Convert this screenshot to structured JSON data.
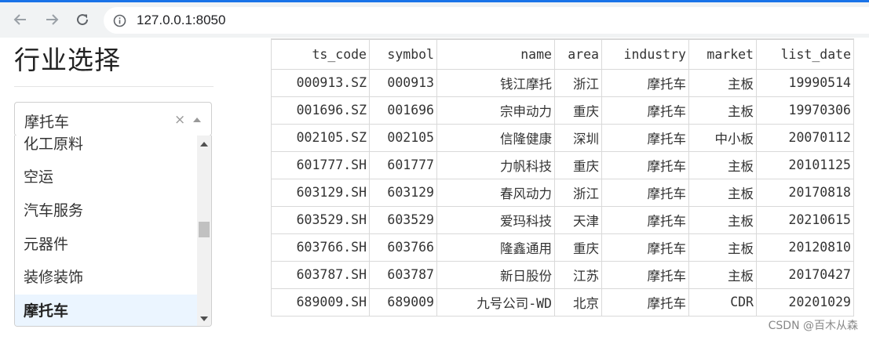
{
  "browser": {
    "url": "127.0.0.1:8050"
  },
  "sidebar": {
    "title": "行业选择",
    "dropdown": {
      "value": "摩托车",
      "clear_symbol": "×",
      "options": [
        "化工原料",
        "空运",
        "汽车服务",
        "元器件",
        "装修装饰",
        "摩托车"
      ]
    }
  },
  "table": {
    "columns": [
      "ts_code",
      "symbol",
      "name",
      "area",
      "industry",
      "market",
      "list_date"
    ],
    "rows": [
      [
        "000913.SZ",
        "000913",
        "钱江摩托",
        "浙江",
        "摩托车",
        "主板",
        "19990514"
      ],
      [
        "001696.SZ",
        "001696",
        "宗申动力",
        "重庆",
        "摩托车",
        "主板",
        "19970306"
      ],
      [
        "002105.SZ",
        "002105",
        "信隆健康",
        "深圳",
        "摩托车",
        "中小板",
        "20070112"
      ],
      [
        "601777.SH",
        "601777",
        "力帆科技",
        "重庆",
        "摩托车",
        "主板",
        "20101125"
      ],
      [
        "603129.SH",
        "603129",
        "春风动力",
        "浙江",
        "摩托车",
        "主板",
        "20170818"
      ],
      [
        "603529.SH",
        "603529",
        "爱玛科技",
        "天津",
        "摩托车",
        "主板",
        "20210615"
      ],
      [
        "603766.SH",
        "603766",
        "隆鑫通用",
        "重庆",
        "摩托车",
        "主板",
        "20120810"
      ],
      [
        "603787.SH",
        "603787",
        "新日股份",
        "江苏",
        "摩托车",
        "主板",
        "20170427"
      ],
      [
        "689009.SH",
        "689009",
        "九号公司-WD",
        "北京",
        "摩托车",
        "CDR",
        "20201029"
      ]
    ]
  },
  "watermark": "CSDN @百木从森"
}
